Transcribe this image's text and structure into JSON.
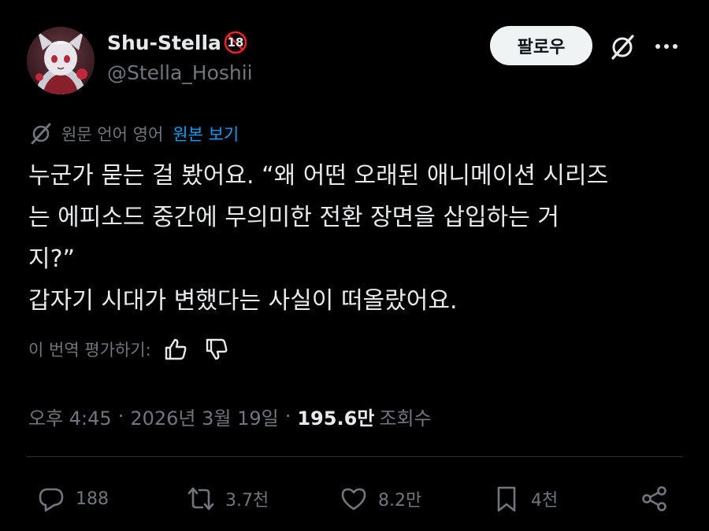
{
  "header": {
    "display_name": "Shu-Stella",
    "age_badge": "18",
    "handle": "@Stella_Hoshii",
    "follow_label": "팔로우",
    "icons": [
      "grok-icon",
      "more-icon"
    ]
  },
  "translation": {
    "label": "원문 언어 영어",
    "show_original": "원본 보기",
    "icon": "translate-icon"
  },
  "post": {
    "lines": [
      "누군가 묻는 걸 봤어요. “왜 어떤 오래된 애니메이션 시리즈",
      "는 에피소드 중간에 무의미한 전환 장면을 삽입하는 거",
      "지?”",
      "갑자기 시대가 변했다는 사실이 떠올랐어요."
    ]
  },
  "rate": {
    "label": "이 번역 평가하기:",
    "icons": [
      "thumbs-up-icon",
      "thumbs-down-icon"
    ]
  },
  "meta": {
    "time": "오후 4:45",
    "date": "2026년 3월 19일",
    "views": "195.6만",
    "views_label": "조회수",
    "separator": "·"
  },
  "actions": {
    "reply": "188",
    "retweet": "3.7천",
    "like": "8.2만",
    "bookmark": "4천"
  },
  "colors": {
    "background": "#000000",
    "text": "#e7e9ea",
    "muted": "#71767b",
    "link": "#1d9bf0",
    "badge_red": "#f4212e"
  }
}
